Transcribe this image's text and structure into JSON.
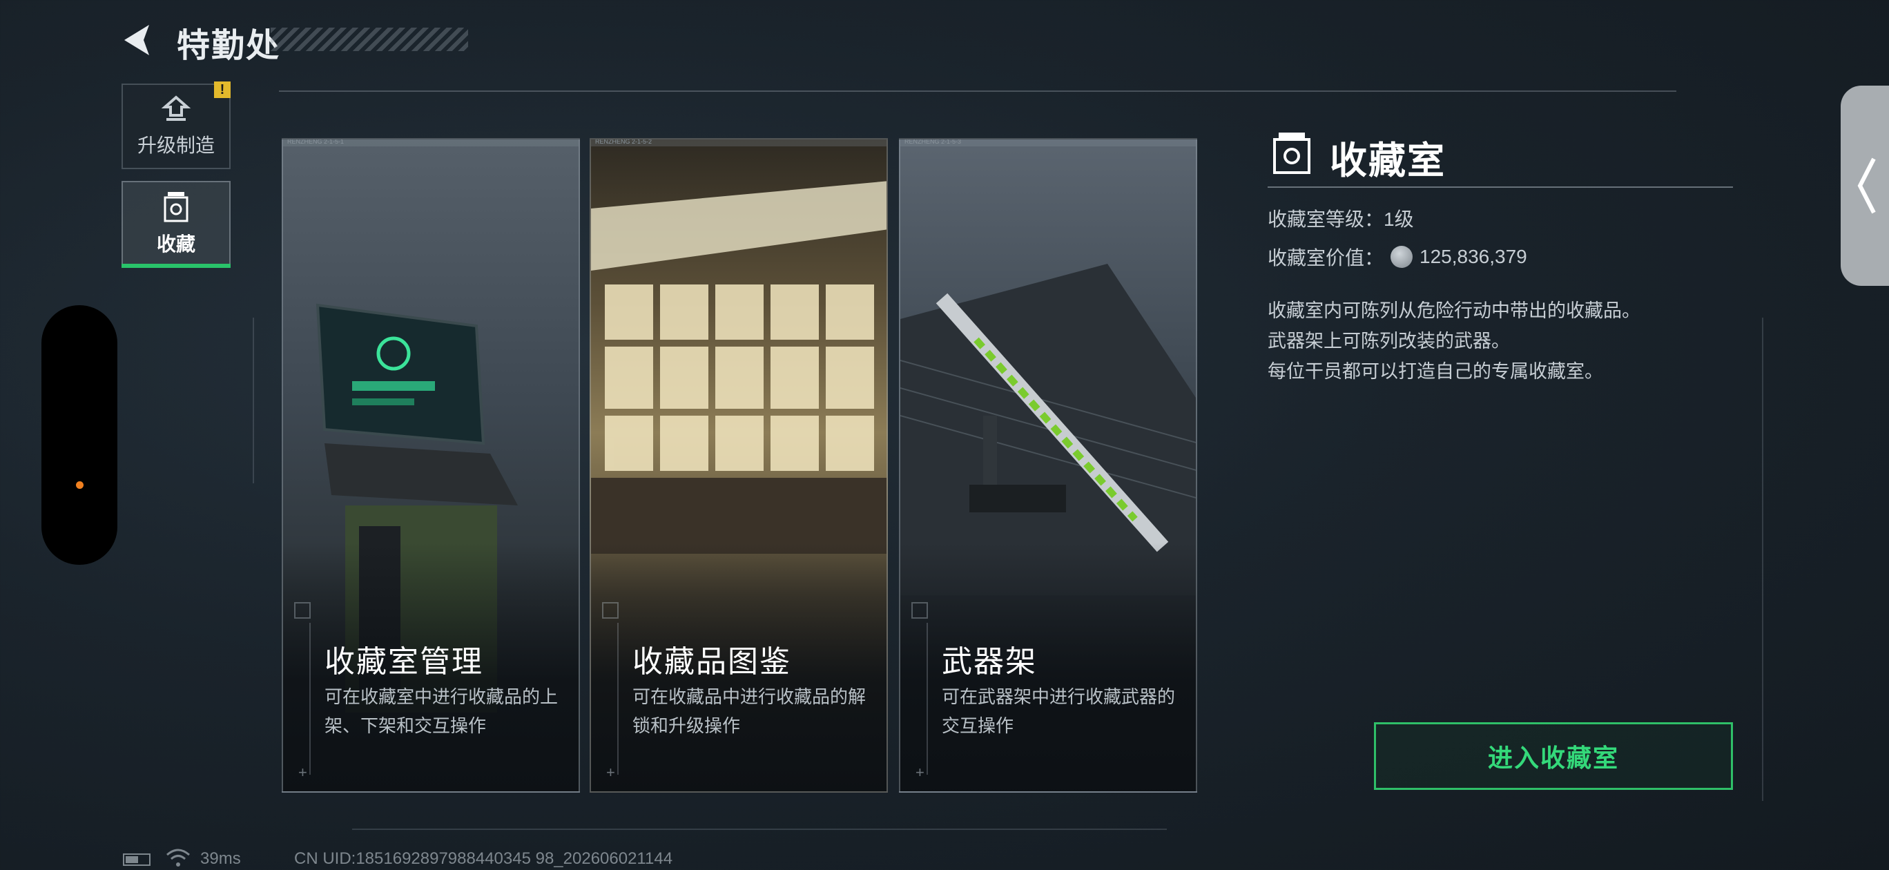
{
  "header": {
    "title": "特勤处",
    "back_icon": "back-arrow-icon"
  },
  "sidebar": {
    "items": [
      {
        "label": "升级制造",
        "icon": "upgrade-icon",
        "badge": "!"
      },
      {
        "label": "收藏",
        "icon": "collection-icon",
        "selected": true
      }
    ]
  },
  "cards": [
    {
      "title": "收藏室管理",
      "desc": "可在收藏室中进行收藏品的上架、下架和交互操作",
      "tiny": "RENZHENG 2-1-5-1"
    },
    {
      "title": "收藏品图鉴",
      "desc": "可在收藏品中进行收藏品的解锁和升级操作",
      "tiny": "RENZHENG 2-1-5-2"
    },
    {
      "title": "武器架",
      "desc": "可在武器架中进行收藏武器的交互操作",
      "tiny": "RENZHENG 2-1-5-3"
    }
  ],
  "panel": {
    "title": "收藏室",
    "level": "收藏室等级：1级",
    "value_label": "收藏室价值：",
    "value": "125,836,379",
    "desc": [
      "收藏室内可陈列从危险行动中带出的收藏品。",
      "武器架上可陈列改装的武器。",
      "每位干员都可以打造自己的专属收藏室。"
    ],
    "enter_button": "进入收藏室"
  },
  "footer": {
    "ping": "39ms",
    "uid": "CN UID:1851692897988440345 98_202606021144"
  },
  "colors": {
    "accent_green": "#2fbf68",
    "badge_yellow": "#e3b92c",
    "dot_orange": "#f08020"
  }
}
